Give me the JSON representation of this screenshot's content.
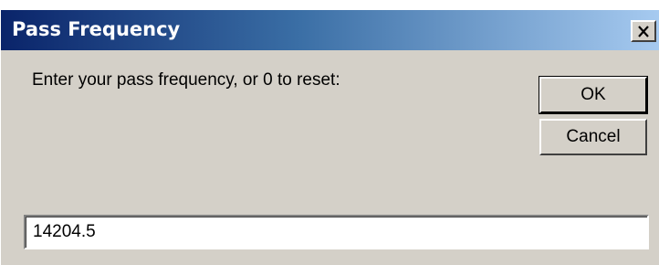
{
  "window": {
    "title": "Pass Frequency",
    "close_icon": "close-icon"
  },
  "dialog": {
    "prompt": "Enter your pass frequency, or 0 to reset:",
    "ok_label": "OK",
    "cancel_label": "Cancel",
    "input_value": "14204.5"
  },
  "colors": {
    "titlebar_start": "#0a246a",
    "titlebar_end": "#a6caf0",
    "dialog_bg": "#d4d0c8"
  }
}
